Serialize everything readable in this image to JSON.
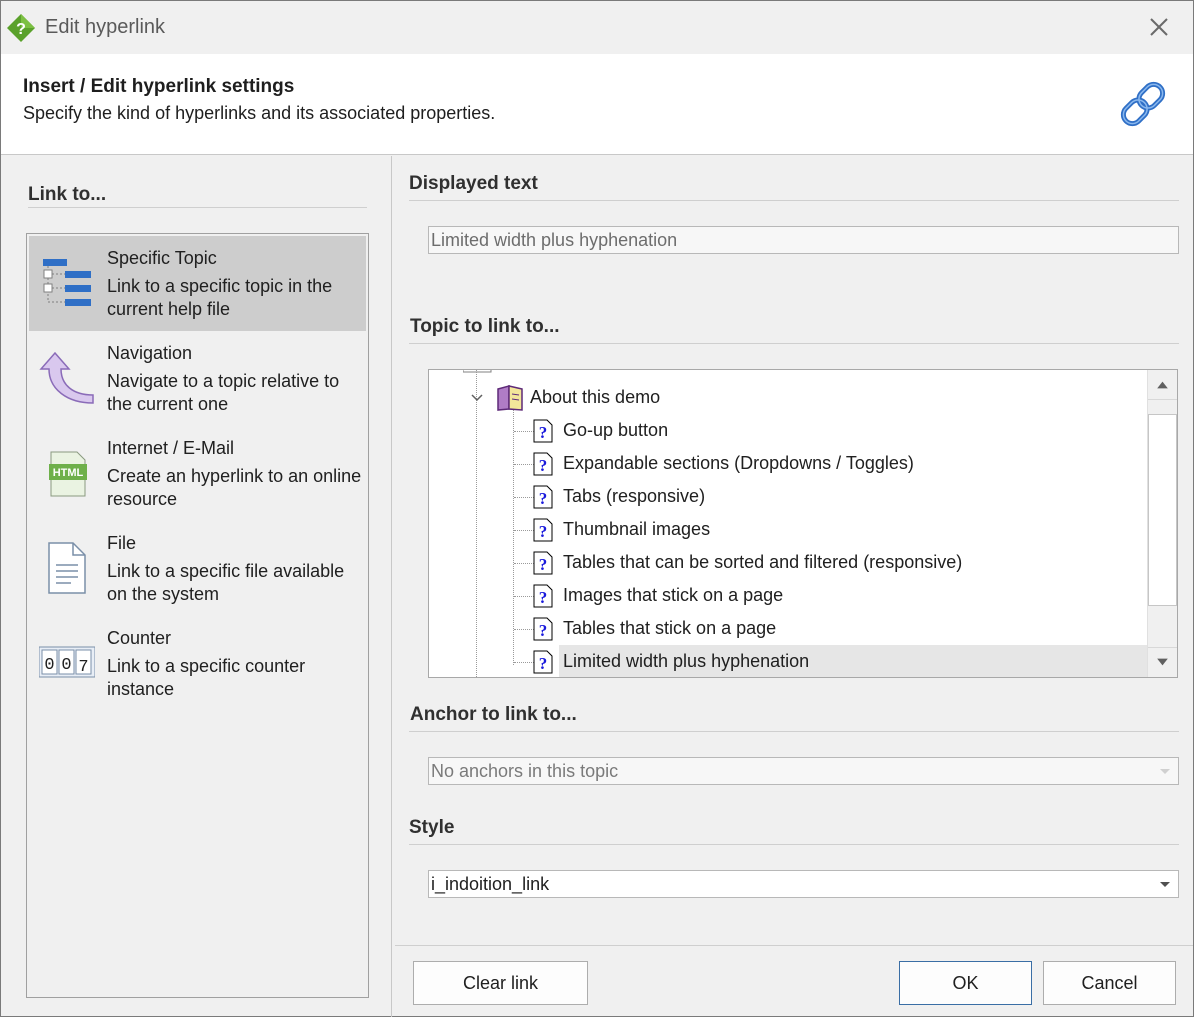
{
  "window": {
    "title": "Edit hyperlink",
    "app_icon": "help-question-diamond-icon",
    "close_icon": "close-icon"
  },
  "header": {
    "title": "Insert / Edit hyperlink settings",
    "subtitle": "Specify the kind of hyperlinks and its associated properties.",
    "icon": "chain-link-icon"
  },
  "left_panel": {
    "heading": "Link to...",
    "items": [
      {
        "title": "Specific Topic",
        "description": "Link to a specific topic in the current help file",
        "icon": "topic-tree-icon",
        "selected": true
      },
      {
        "title": "Navigation",
        "description": "Navigate to a topic relative to the current one",
        "icon": "curved-arrow-icon",
        "selected": false
      },
      {
        "title": "Internet / E-Mail",
        "description": "Create an hyperlink to an online resource",
        "icon": "html-page-icon",
        "selected": false
      },
      {
        "title": "File",
        "description": "Link to a specific file available on the system",
        "icon": "document-icon",
        "selected": false
      },
      {
        "title": "Counter",
        "description": "Link to a specific counter instance",
        "icon": "counter-icon",
        "selected": false
      }
    ],
    "counter_digits": [
      "0",
      "0",
      "7"
    ]
  },
  "right_panel": {
    "displayed_text_label": "Displayed text",
    "displayed_text_value": "Limited width plus hyphenation",
    "topic_label": "Topic to link to...",
    "tree": {
      "parent": "About this demo",
      "children": [
        "Go-up button",
        "Expandable sections (Dropdowns / Toggles)",
        "Tabs (responsive)",
        "Thumbnail images",
        "Tables that can be sorted and filtered (responsive)",
        "Images that stick on a page",
        "Tables that stick on a page",
        "Limited width plus hyphenation"
      ],
      "selected": "Limited width plus hyphenation"
    },
    "anchor_label": "Anchor to link to...",
    "anchor_value": "No anchors in this topic",
    "style_label": "Style",
    "style_value": "i_indoition_link"
  },
  "buttons": {
    "clear": "Clear link",
    "ok": "OK",
    "cancel": "Cancel"
  },
  "colors": {
    "accent_blue": "#2f6fc6",
    "selection_gray": "#cdcdcd",
    "book_purple": "#7b2d8e",
    "app_green": "#5aa12b"
  }
}
